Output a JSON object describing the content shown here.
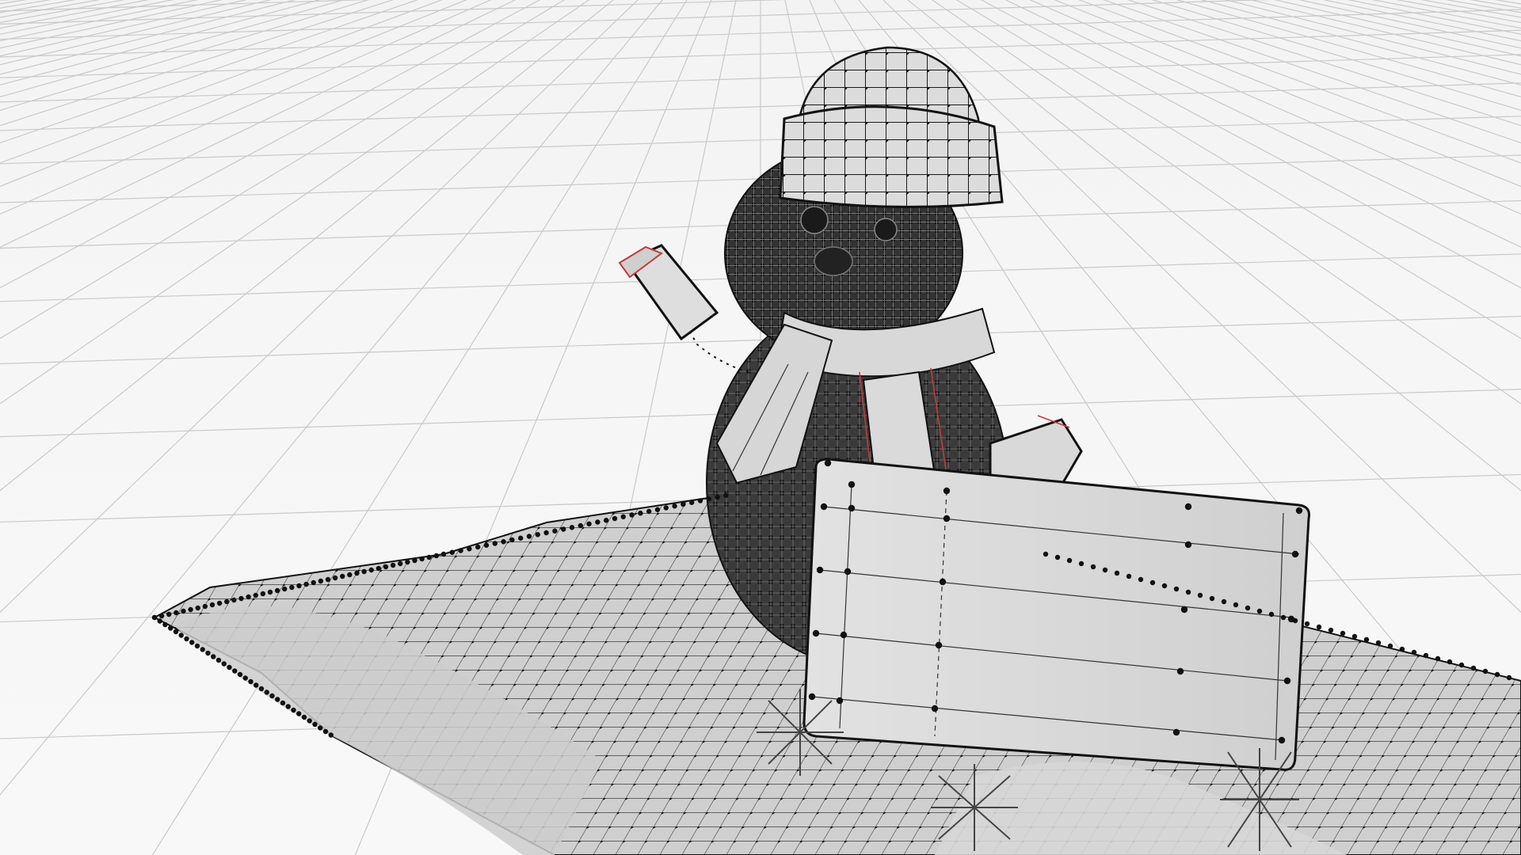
{
  "viewport": {
    "background_color": "#f6f6f6",
    "grid_color": "#c9c9c9",
    "mesh_vertex_color": "#111111",
    "mesh_surface_color": "#c8c8c8",
    "selection_edge_color": "#c23a3a"
  },
  "scene": {
    "objects": [
      {
        "name": "snowman-body",
        "icon": "snowman-icon"
      },
      {
        "name": "snowman-hat"
      },
      {
        "name": "snowman-scarf"
      },
      {
        "name": "snowman-left-arm"
      },
      {
        "name": "snowman-right-arm"
      },
      {
        "name": "sign-board"
      },
      {
        "name": "snow-ground"
      },
      {
        "name": "snowflake-decorations"
      }
    ]
  }
}
